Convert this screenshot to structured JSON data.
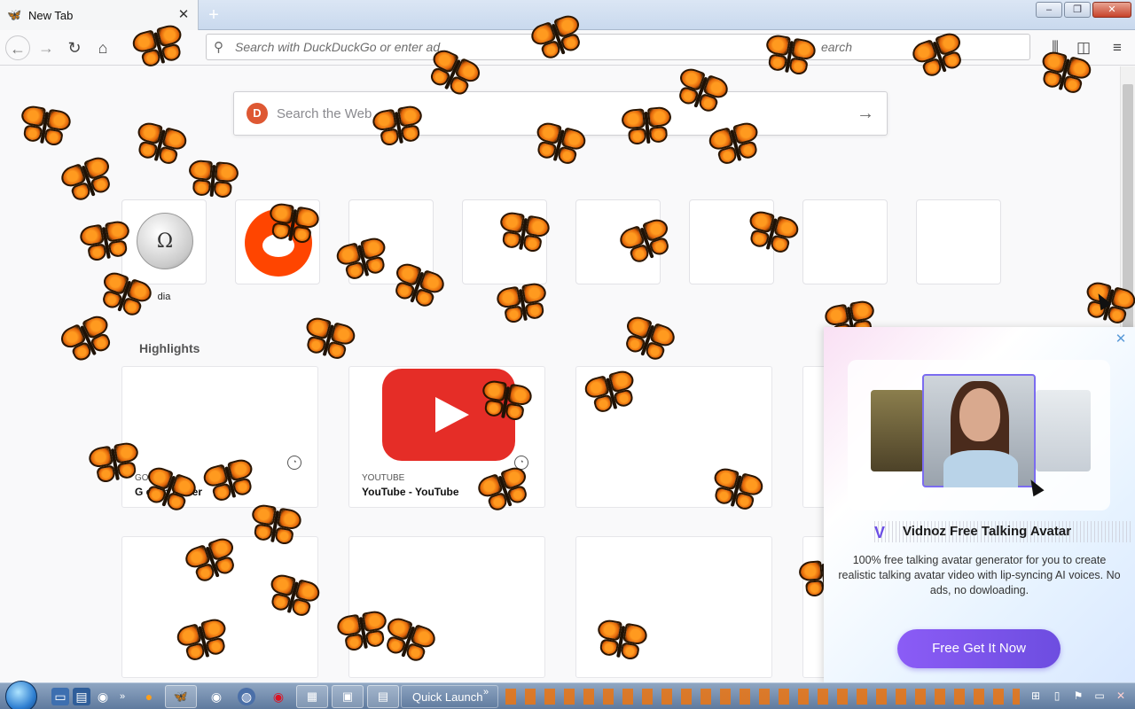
{
  "browser": {
    "tab": {
      "title": "New Tab",
      "favicon": "butterfly-icon",
      "close": "✕"
    },
    "new_tab_label": "+",
    "window_controls": {
      "minimize": "–",
      "restore": "❐",
      "close": "✕"
    },
    "nav": {
      "back": "←",
      "forward": "→",
      "reload": "↻",
      "home": "⌂"
    },
    "url_placeholder": "Search with DuckDuckGo or enter ad",
    "url_search_hint": "earch",
    "toolbar": {
      "library": "⫼",
      "sidebar": "◫",
      "menu": "≡"
    }
  },
  "newtab": {
    "search_placeholder": "Search the Web",
    "search_icon_letter": "D",
    "search_submit": "→",
    "top_sites": [
      {
        "label": "wikipedia",
        "visible_label": "dia"
      },
      {
        "label": "reddit"
      },
      {
        "label": ""
      },
      {
        "label": ""
      },
      {
        "label": ""
      },
      {
        "label": ""
      },
      {
        "label": ""
      },
      {
        "label": ""
      }
    ],
    "highlights_title": "Highlights",
    "highlights": [
      {
        "source": "GO",
        "title": "Google Chrome Web Browser",
        "title_visible": "G   e Ch    b B     er"
      },
      {
        "source": "YOUTUBE",
        "title": "YouTube - YouTube"
      },
      {
        "source": "",
        "title": ""
      },
      {
        "source": "",
        "title": ""
      }
    ]
  },
  "ad": {
    "brand_icon": "V",
    "title": "Vidnoz Free Talking Avatar",
    "description": "100% free talking avatar generator for you to create realistic talking avatar video with lip-syncing AI voices. No ads, no dowloading.",
    "cta": "Free Get It Now",
    "close": "✕"
  },
  "taskbar": {
    "quick_launch": "Quick Launch",
    "chevron": "»"
  }
}
